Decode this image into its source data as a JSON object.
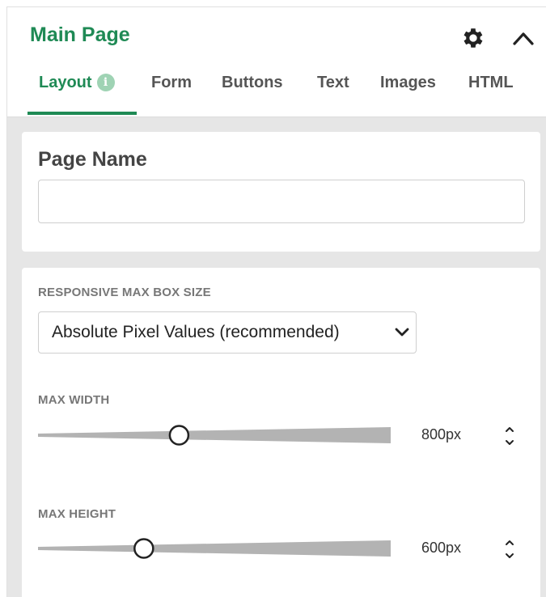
{
  "header": {
    "title": "Main Page",
    "tabs": [
      {
        "label": "Layout",
        "active": true,
        "badge": "i"
      },
      {
        "label": "Form"
      },
      {
        "label": "Buttons"
      },
      {
        "label": "Text"
      },
      {
        "label": "Images"
      },
      {
        "label": "HTML"
      }
    ],
    "icons": {
      "settings": "gear-icon",
      "collapse": "chevron-up-icon"
    }
  },
  "page_name": {
    "label": "Page Name",
    "value": "",
    "placeholder": ""
  },
  "responsive": {
    "label": "RESPONSIVE MAX BOX SIZE",
    "selected": "Absolute Pixel Values (recommended)"
  },
  "max_width": {
    "label": "MAX WIDTH",
    "value": "800px",
    "fraction": 0.4
  },
  "max_height": {
    "label": "MAX HEIGHT",
    "value": "600px",
    "fraction": 0.3
  },
  "colors": {
    "accent": "#1f8a55",
    "track": "#b3b3b3"
  }
}
